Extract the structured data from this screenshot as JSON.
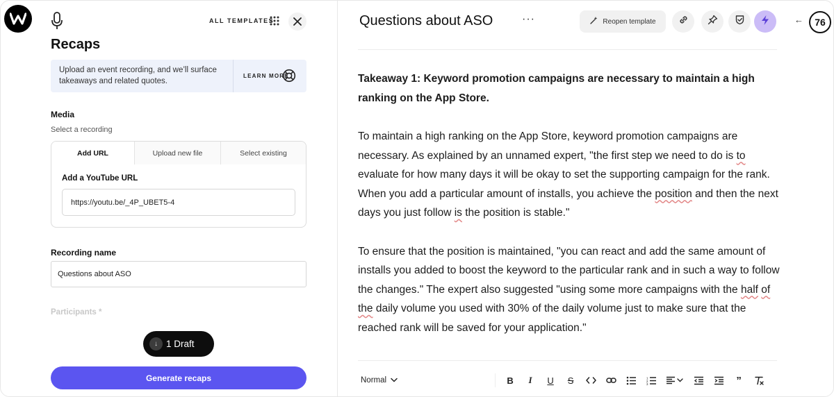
{
  "left_panel": {
    "all_templates_label": "ALL TEMPLATES",
    "title": "Recaps",
    "info_text": "Upload an event recording, and we’ll surface takeaways and related quotes.",
    "learn_more_label": "LEARN MORE",
    "media_label": "Media",
    "media_sublabel": "Select a recording",
    "tabs": [
      {
        "label": "Add URL",
        "active": true
      },
      {
        "label": "Upload new file",
        "active": false
      },
      {
        "label": "Select existing",
        "active": false
      }
    ],
    "youtube_label": "Add a YouTube URL",
    "youtube_url_value": "https://youtu.be/_4P_UBET5-4",
    "recording_name_label": "Recording name",
    "recording_name_value": "Questions about ASO",
    "participants_label": "Participants *",
    "draft_label": "1 Draft",
    "generate_label": "Generate recaps"
  },
  "right_panel": {
    "doc_title": "Questions about ASO",
    "more_label": "···",
    "reopen_label": "Reopen template",
    "score": "76",
    "takeaway_line": "Takeaway 1: Keyword promotion campaigns are necessary to maintain a high ranking on the App Store.",
    "toolbar_style_label": "Normal"
  },
  "colors": {
    "accent": "#5b55f0",
    "bolt_bg": "#cbbcf7",
    "info_bg": "#eef2fb"
  },
  "icons": [
    "logo-w-icon",
    "microphone-icon",
    "grid-icon",
    "close-icon",
    "lifebuoy-icon",
    "download-arrow-icon",
    "magic-wand-icon",
    "link-icon",
    "pin-icon",
    "shield-check-icon",
    "bolt-icon",
    "arrow-left-icon"
  ]
}
